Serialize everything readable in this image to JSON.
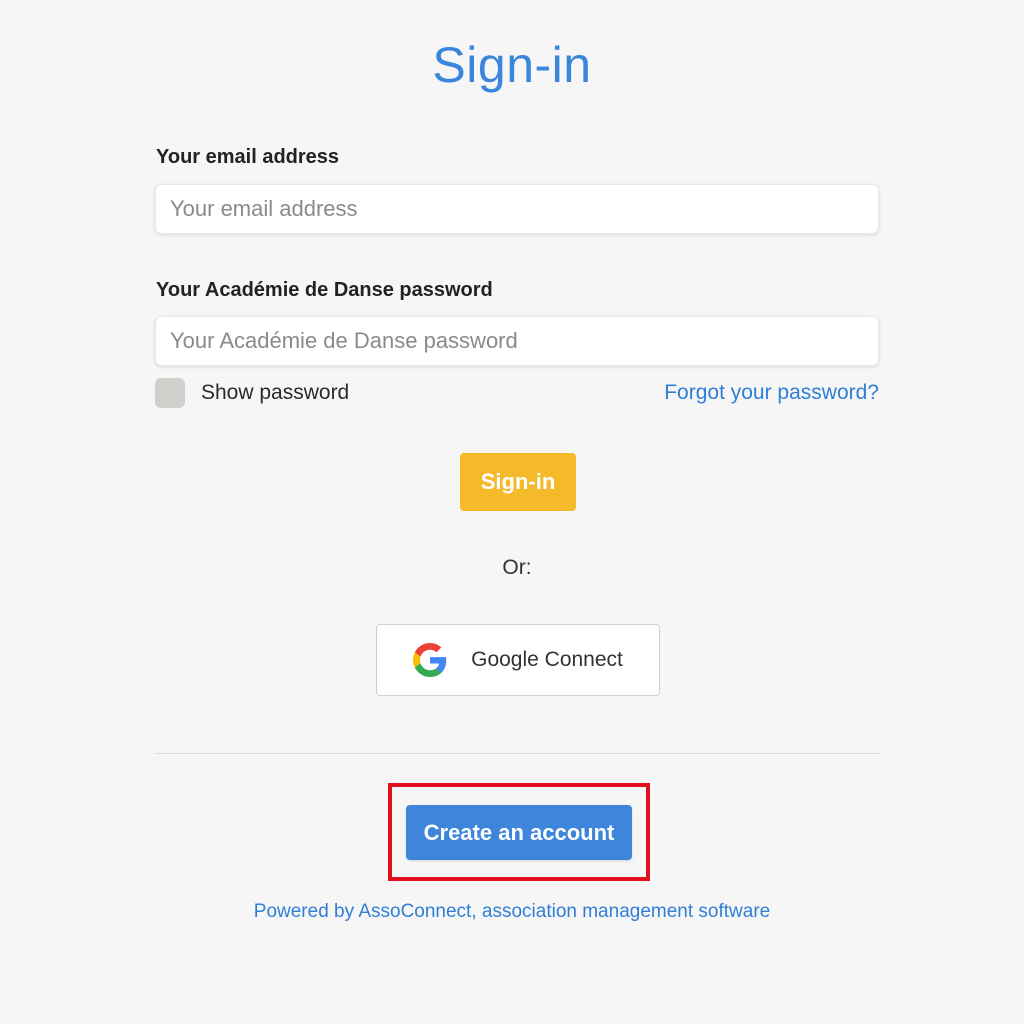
{
  "page": {
    "title": "Sign-in"
  },
  "form": {
    "email": {
      "label": "Your email address",
      "placeholder": "Your email address",
      "value": ""
    },
    "password": {
      "label": "Your Académie de Danse password",
      "placeholder": "Your Académie de Danse password",
      "value": ""
    },
    "show_password": {
      "label": "Show password",
      "checked": false
    },
    "forgot_password_link": "Forgot your password?",
    "signin_button": "Sign-in"
  },
  "alternatives": {
    "or_text": "Or:",
    "google_button": {
      "label": "Google Connect",
      "icon": "google-g-icon"
    }
  },
  "footer": {
    "create_account_button": "Create an account",
    "powered_by_link": "Powered by AssoConnect, association management software"
  },
  "colors": {
    "title": "#3a86dd",
    "signin_button": "#f5ba2a",
    "create_account_button": "#3d86dc",
    "link": "#2f7fd6",
    "highlight": "#e0101e",
    "background": "#f6f6f6"
  }
}
